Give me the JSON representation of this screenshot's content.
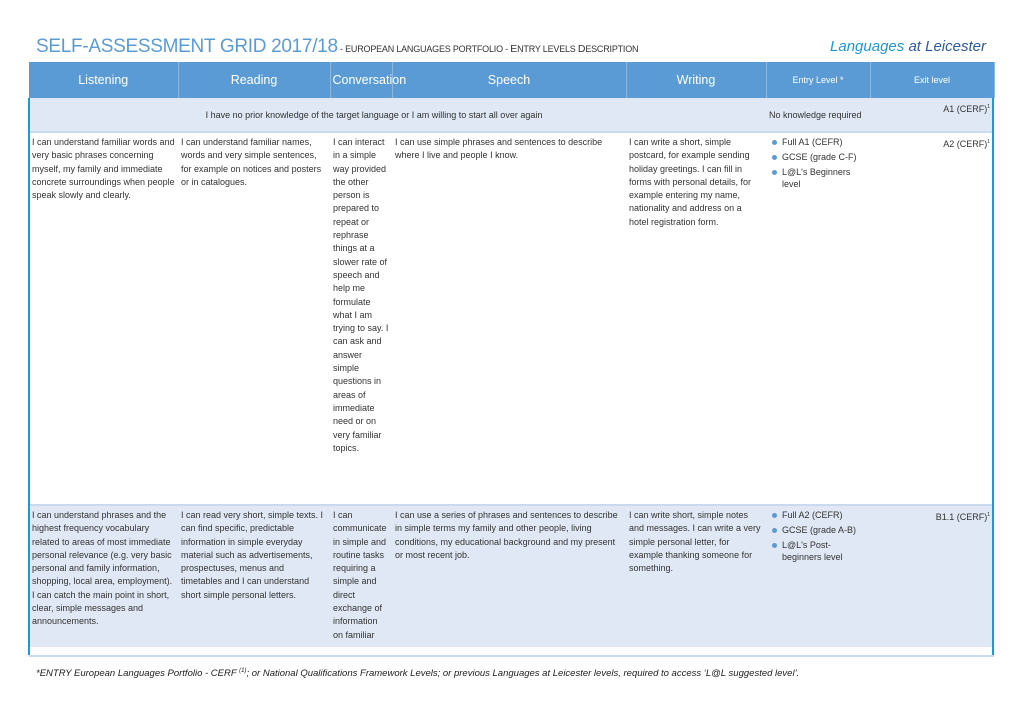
{
  "header": {
    "title": "SELF-ASSESSMENT GRID 2017/18",
    "subtitle_prefix": " - EUROPEAN LANGUAGES PORTFOLIO - ",
    "subtitle_e": "E",
    "subtitle_ntry": "NTRY LEVELS ",
    "subtitle_d": "D",
    "subtitle_escription": "ESCRIPTION",
    "brand_part1": "Languages",
    "brand_part2": " at Leicester"
  },
  "table": {
    "columns": [
      "Listening",
      "Reading",
      "Conversation",
      "Speech",
      "Writing",
      "Entry Level *",
      "Exit level"
    ],
    "rows": [
      {
        "merged_text": "I have no prior knowledge of the target language or I am willing to start all over again",
        "entry_text": "No knowledge required",
        "exit": "A1 (CERF)",
        "exit_sup": "1"
      },
      {
        "listening": "I can understand familiar words and very basic phrases concerning myself, my family and immediate concrete surroundings when people speak slowly and clearly.",
        "reading": "I can understand familiar names, words and very simple sentences, for example on notices and posters or in catalogues.",
        "conversation": "I can interact in a simple way provided the other person is prepared to repeat or rephrase things at a slower rate of speech and help me formulate what I am trying to say. I can ask and answer simple questions in areas of immediate need or on very familiar topics.",
        "speech": "I can use simple phrases and sentences to describe where I live and people I know.",
        "writing": "I can write a short, simple postcard, for example sending holiday greetings. I can fill in forms with personal details, for example entering my name, nationality and address on a hotel registration form.",
        "entry": [
          "Full A1 (CEFR)",
          "GCSE (grade C-F)",
          "L@L's Beginners level"
        ],
        "exit": "A2 (CERF)",
        "exit_sup": "1"
      },
      {
        "listening": "I can understand phrases and the highest frequency vocabulary related to areas of most immediate personal relevance (e.g. very basic personal and family information, shopping, local area, employment). I can catch the main point in short, clear, simple messages and announcements.",
        "reading": "I can read very short, simple texts. I can find specific, predictable information in simple everyday material such as advertisements, prospectuses, menus and timetables and I can understand short simple personal letters.",
        "conversation": "I can communicate in simple and routine tasks requiring a simple and direct exchange of information on familiar",
        "speech": "I can use a series of phrases and sentences to describe in simple terms my family and other people, living conditions, my educational background and my present or most recent job.",
        "writing": "I can write short, simple notes and messages. I can write a very simple personal letter, for example thanking someone for something.",
        "entry": [
          "Full A2 (CEFR)",
          "GCSE (grade A-B)",
          "L@L's Post-beginners level"
        ],
        "exit": "B1.1 (CERF)",
        "exit_sup": "1"
      }
    ]
  },
  "footnote": {
    "before_sup": "*ENTRY European Languages Portfolio - CERF ",
    "sup": "(1)",
    "after_sup": "; or National Qualifications Framework Levels; or previous Languages at Leicester levels, required to access ‘L@L suggested level’."
  },
  "colors": {
    "accent": "#5b9bd5",
    "row_shade": "#dfe8f4",
    "border_accent": "#1c9ad6"
  }
}
